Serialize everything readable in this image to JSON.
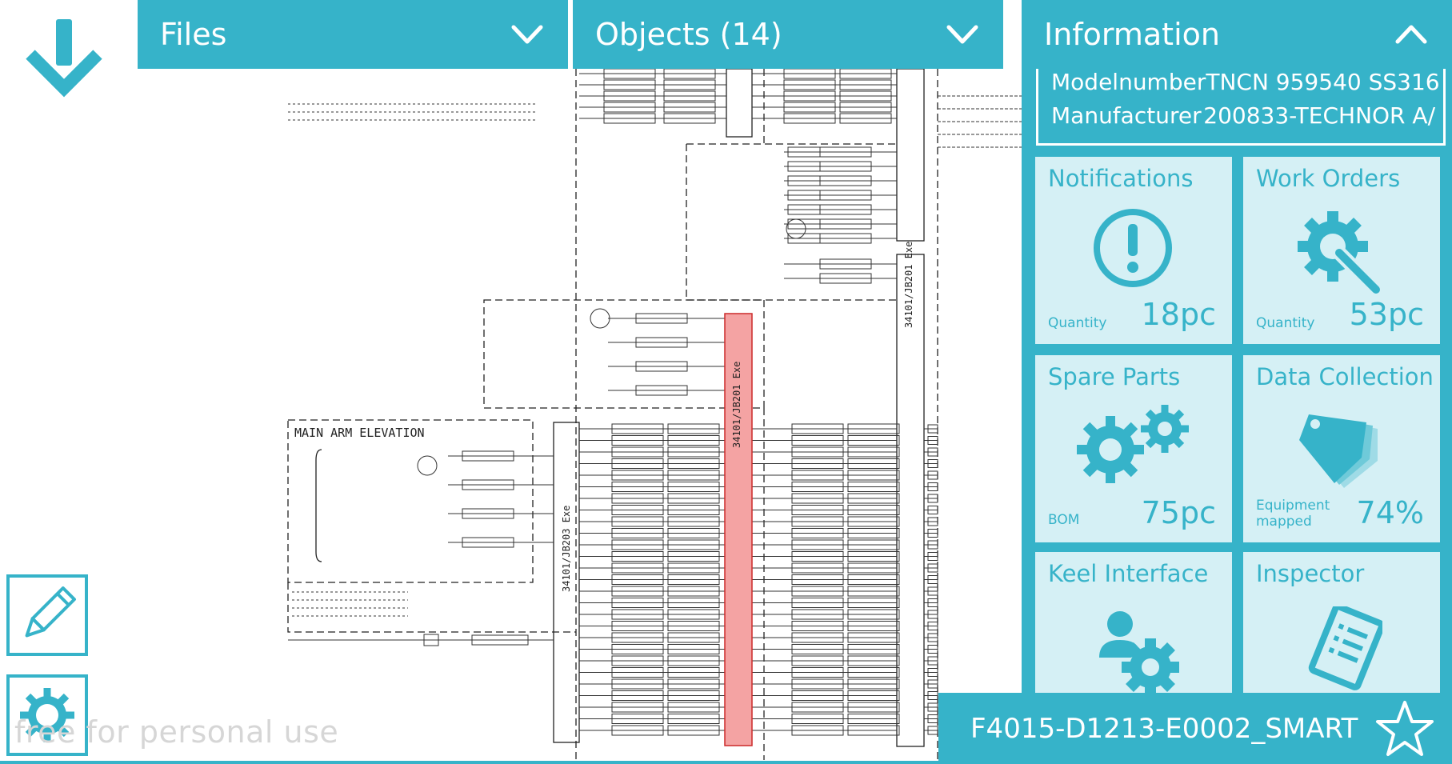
{
  "header": {
    "files_label": "Files",
    "objects_label": "Objects (14)",
    "info_label": "Information"
  },
  "info": {
    "model_key": "Modelnumber",
    "model_value": "TNCN 959540 SS316",
    "manufacturer_key": "Manufacturer",
    "manufacturer_value": "200833-TECHNOR A/"
  },
  "tiles": {
    "notifications": {
      "title": "Notifications",
      "qty_label": "Quantity",
      "value": "18pc",
      "icon": "alert-circle-icon"
    },
    "work_orders": {
      "title": "Work Orders",
      "qty_label": "Quantity",
      "value": "53pc",
      "icon": "gear-wrench-icon"
    },
    "spare_parts": {
      "title": "Spare Parts",
      "qty_label": "BOM",
      "value": "75pc",
      "icon": "gears-icon"
    },
    "data_collection": {
      "title": "Data Collection",
      "qty_label_1": "Equipment",
      "qty_label_2": "mapped",
      "value": "74%",
      "icon": "tags-icon"
    },
    "keel_interface": {
      "title": "Keel Interface",
      "icon": "person-gear-icon"
    },
    "inspector": {
      "title": "Inspector",
      "icon": "clipboard-icon"
    }
  },
  "document": {
    "name": "F4015-D1213-E0002_SMART"
  },
  "diagram": {
    "section_title": "MAIN ARM ELEVATION",
    "highlighted_label": "34101/JB201 Exe",
    "junction_label": "34101/JB203 Exe",
    "junction_label_2": "34101/JB201 Exe"
  },
  "watermark": "free for personal use",
  "colors": {
    "accent": "#36b3c9",
    "tile_bg": "#d5f0f5",
    "highlight": "#f4a3a3"
  }
}
